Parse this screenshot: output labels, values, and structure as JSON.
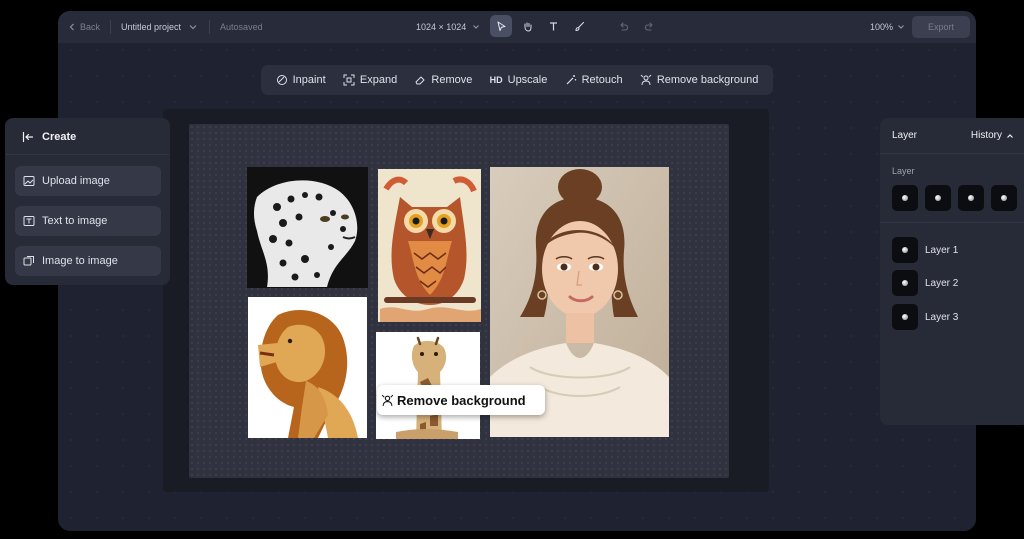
{
  "topbar": {
    "back_label": "Back",
    "project_name": "Untitled project",
    "save_status": "Autosaved",
    "canvas_size": "1024 × 1024",
    "zoom": "100%",
    "export_label": "Export"
  },
  "actions": [
    {
      "label": "Inpaint",
      "icon": "inpaint-icon"
    },
    {
      "label": "Expand",
      "icon": "expand-icon"
    },
    {
      "label": "Remove",
      "icon": "eraser-icon"
    },
    {
      "label": "Upscale",
      "icon": "hd-icon",
      "prefix": "HD"
    },
    {
      "label": "Retouch",
      "icon": "wand-icon"
    },
    {
      "label": "Remove background",
      "icon": "remove-bg-icon"
    }
  ],
  "create_panel": {
    "title": "Create",
    "buttons": [
      {
        "label": "Upload image",
        "icon": "upload-image-icon"
      },
      {
        "label": "Text to image",
        "icon": "text-to-image-icon"
      },
      {
        "label": "Image to image",
        "icon": "image-to-image-icon"
      }
    ]
  },
  "canvas": {
    "tag_label": "Remove background"
  },
  "layer_panel": {
    "tab_layer": "Layer",
    "tab_history": "History",
    "section_label": "Layer",
    "layers": [
      {
        "label": "Layer 1"
      },
      {
        "label": "Layer 2"
      },
      {
        "label": "Layer 3"
      }
    ]
  },
  "colors": {
    "app_bg": "#1f2230",
    "panel_bg": "#272a37",
    "accent_active_tool": "#4a4f63"
  }
}
